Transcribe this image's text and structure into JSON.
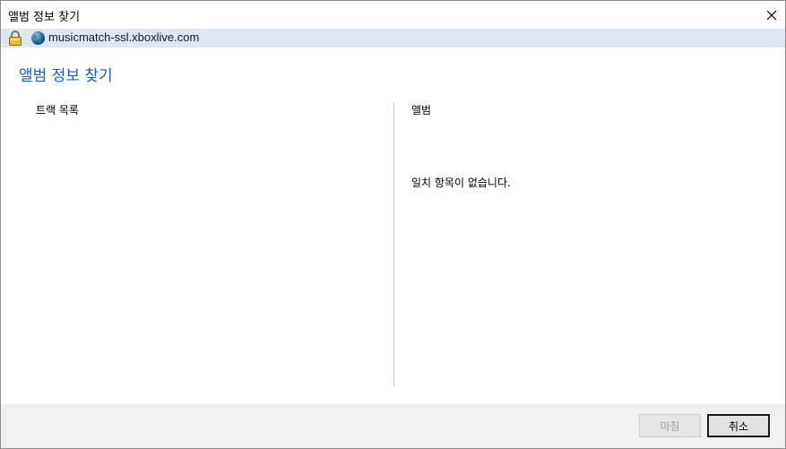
{
  "window": {
    "title": "앨범 정보 찾기"
  },
  "address_bar": {
    "url": "musicmatch-ssl.xboxlive.com",
    "lock_icon": "lock-icon",
    "globe_icon": "globe-icon"
  },
  "main": {
    "heading": "앨범 정보 찾기",
    "track_list_label": "트랙 목록",
    "album_label": "앨범",
    "no_match_text": "일치 항목이 없습니다."
  },
  "footer": {
    "finish_label": "마침",
    "cancel_label": "취소"
  },
  "colors": {
    "heading": "#1d5fa8",
    "address_bar_bg": "#dce7f3",
    "footer_bg": "#f0f0f0"
  }
}
